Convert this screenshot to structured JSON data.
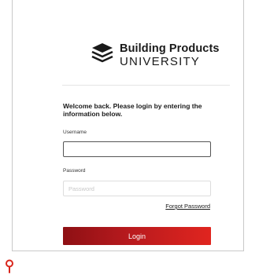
{
  "brand": {
    "line1": "Building Products",
    "line2": "UNIVERSITY",
    "logo_icon": "stacked-layers-icon"
  },
  "login": {
    "welcome_text": "Welcome back. Please login by entering the information below.",
    "username_label": "Username",
    "username_value": "",
    "username_placeholder": "",
    "password_label": "Password",
    "password_value": "",
    "password_placeholder": "Password",
    "forgot_password_label": "Forgot Password",
    "submit_label": "Login"
  },
  "location_marker_icon": "map-pin-icon",
  "colors": {
    "accent_start": "#8e1014",
    "accent_end": "#e0251f",
    "pin": "#d9261c"
  }
}
